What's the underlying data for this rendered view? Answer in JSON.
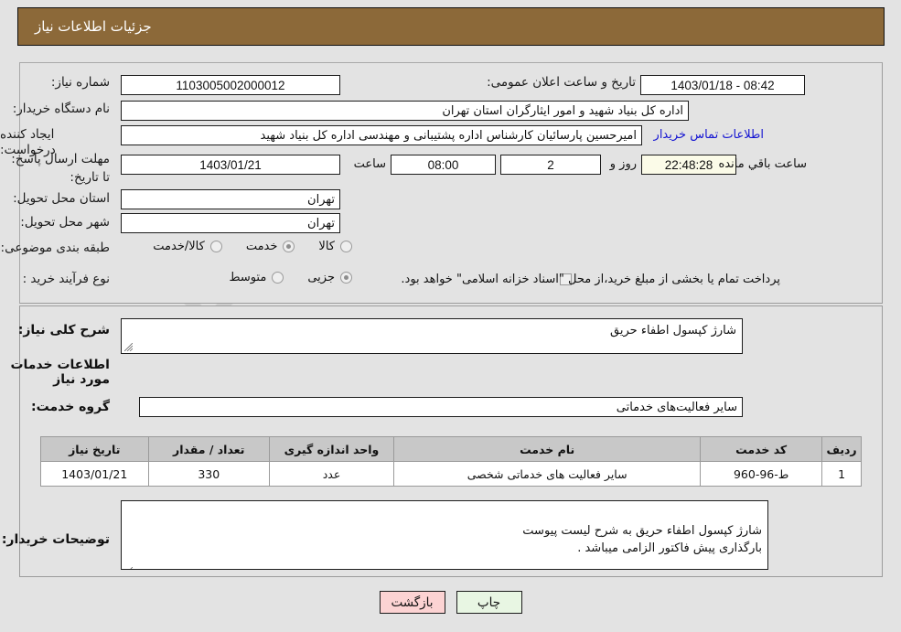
{
  "header": {
    "title": "جزئیات اطلاعات نیاز",
    "bg_color": "#8c6939",
    "text_color": "#ffffff"
  },
  "watermark": {
    "text_left": "Ana",
    "text_right": "Tender",
    "text_tld": ".net"
  },
  "fields": {
    "need_number": {
      "label": "شماره نیاز:",
      "value": "1103005002000012"
    },
    "public_announcement": {
      "label": "تاریخ و ساعت اعلان عمومی:",
      "value": "1403/01/18 - 08:42"
    },
    "buyer_org": {
      "label": "نام دستگاه خریدار:",
      "value": "اداره کل بنیاد شهید و امور ایثارگران استان تهران"
    },
    "request_creator": {
      "label": "ایجاد کننده درخواست:",
      "value": "امیرحسین پارسائیان کارشناس اداره پشتیبانی و مهندسی  اداره کل بنیاد شهید",
      "link": "اطلاعات تماس خریدار"
    },
    "response_deadline": {
      "label": "مهلت ارسال پاسخ: تا تاریخ:",
      "value": "1403/01/21"
    },
    "deadline_hour": {
      "label": "ساعت",
      "value": "08:00"
    },
    "days_remaining": {
      "label": "روز و",
      "value": "2"
    },
    "time_remaining": {
      "value": "22:48:28",
      "suffix": "ساعت باقي مانده"
    },
    "delivery_province": {
      "label": "استان محل تحویل:",
      "value": "تهران"
    },
    "delivery_city": {
      "label": "شهر محل تحویل:",
      "value": "تهران"
    },
    "category": {
      "label": "طبقه بندی موضوعی:",
      "options": [
        {
          "label": "کالا",
          "selected": false
        },
        {
          "label": "خدمت",
          "selected": true
        },
        {
          "label": "کالا/خدمت",
          "selected": false
        }
      ]
    },
    "purchase_process": {
      "label": "نوع فرآیند خرید :",
      "options": [
        {
          "label": "جزیی",
          "selected": true
        },
        {
          "label": "متوسط",
          "selected": false
        }
      ],
      "checkbox_label": "پرداخت تمام یا بخشی از مبلغ خرید،از محل \"اسناد خزانه اسلامی\" خواهد بود.",
      "checkbox_checked": false
    },
    "general_description": {
      "label": "شرح کلی نیاز:",
      "value": "شارژ کپسول اطفاء حریق"
    },
    "services_section_title": "اطلاعات خدمات مورد نیاز",
    "service_group": {
      "label": "گروه خدمت:",
      "value": "سایر فعالیت‌های خدماتی"
    },
    "buyer_notes": {
      "label": "توضیحات خریدار:",
      "value": "شارژ کپسول اطفاء حریق به شرح لیست پیوست\nبارگذاری پیش فاکتور الزامی میباشد ."
    }
  },
  "table": {
    "headers": [
      "ردیف",
      "کد خدمت",
      "نام خدمت",
      "واحد اندازه گیری",
      "تعداد / مقدار",
      "تاریخ نیاز"
    ],
    "rows": [
      {
        "row_no": "1",
        "service_code": "ط-96-960",
        "service_name": "سایر فعالیت های خدماتی شخصی",
        "unit": "عدد",
        "quantity": "330",
        "need_date": "1403/01/21"
      }
    ]
  },
  "buttons": {
    "back": {
      "label": "بازگشت",
      "color": "#fcd3d3"
    },
    "print": {
      "label": "چاپ",
      "color": "#e8f6e3"
    }
  }
}
